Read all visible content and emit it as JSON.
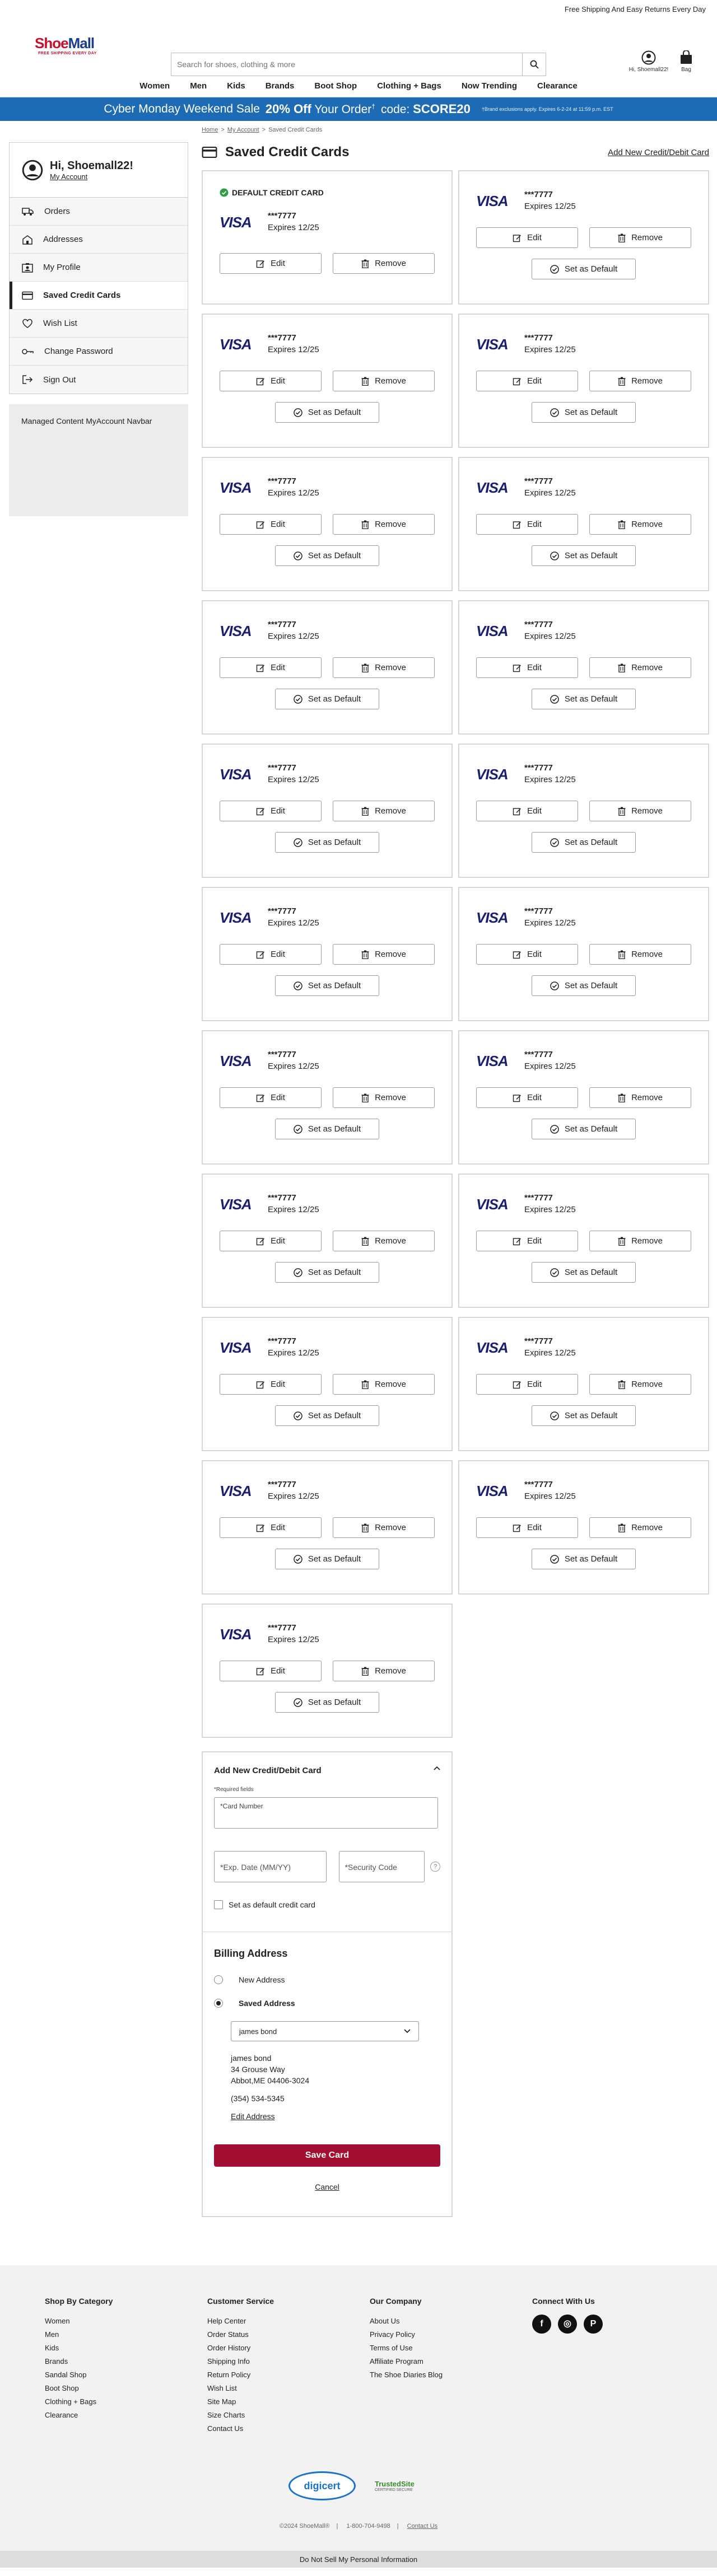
{
  "topbar": {
    "text": "Free Shipping And Easy Returns Every Day"
  },
  "header": {
    "logo_text_a": "Shoe",
    "logo_text_b": "Mall",
    "logo_tagline": "FREE SHIPPING EVERY DAY",
    "search_placeholder": "Search for shoes, clothing & more",
    "account_label": "Hi, Shoemall22!",
    "bag_label": "Bag"
  },
  "nav": {
    "items": [
      "Women",
      "Men",
      "Kids",
      "Brands",
      "Boot Shop",
      "Clothing + Bags",
      "Now Trending",
      "Clearance"
    ]
  },
  "promo": {
    "lead": "Cyber Monday Weekend Sale",
    "discount": "20% Off",
    "your_order": "Your Order",
    "dagger": "†",
    "code_label": "code:",
    "code": "SCORE20",
    "fine_print": "†Brand exclusions apply. Expires 6-2-24 at 11:59 p.m. EST"
  },
  "sidebar": {
    "greeting": "Hi, Shoemall22!",
    "my_account": "My Account",
    "items": [
      "Orders",
      "Addresses",
      "My Profile",
      "Saved Credit Cards",
      "Wish List",
      "Change Password",
      "Sign Out"
    ],
    "active_index": 3,
    "managed_content": "Managed Content MyAccount Navbar"
  },
  "breadcrumb": {
    "home": "Home",
    "account": "My Account",
    "current": "Saved Credit Cards",
    "sep": ">"
  },
  "page": {
    "title": "Saved Credit Cards",
    "add_link": "Add New Credit/Debit Card"
  },
  "cards": {
    "default_label": "DEFAULT CREDIT CARD",
    "brand": "VISA",
    "number": "***7777",
    "expiry": "Expires 12/25",
    "edit_label": "Edit",
    "remove_label": "Remove",
    "set_default_label": "Set as Default",
    "count": 21
  },
  "form": {
    "title": "Add New Credit/Debit Card",
    "required_note": "*Required fields",
    "card_number_label": "*Card Number",
    "exp_label": "*Exp. Date (MM/YY)",
    "cvv_label": "*Security Code",
    "help_glyph": "?",
    "default_checkbox": "Set as default credit card",
    "billing_title": "Billing Address",
    "new_address": "New Address",
    "saved_address": "Saved Address",
    "selected_address": "james bond",
    "addr_name": "james bond",
    "addr_line1": "34 Grouse Way",
    "addr_line2": "Abbot,ME 04406-3024",
    "phone": "(354) 534-5345",
    "edit_address": "Edit Address",
    "save_button": "Save Card",
    "cancel": "Cancel"
  },
  "footer": {
    "col1_title": "Shop By Category",
    "col1": [
      "Women",
      "Men",
      "Kids",
      "Brands",
      "Sandal Shop",
      "Boot Shop",
      "Clothing + Bags",
      "Clearance"
    ],
    "col2_title": "Customer Service",
    "col2": [
      "Help Center",
      "Order Status",
      "Order History",
      "Shipping Info",
      "Return Policy",
      "Wish List",
      "Site Map",
      "Size Charts",
      "Contact Us"
    ],
    "col3_title": "Our Company",
    "col3": [
      "About Us",
      "Privacy Policy",
      "Terms of Use",
      "Affiliate Program",
      "The Shoe Diaries Blog"
    ],
    "col4_title": "Connect With Us",
    "social": [
      "f",
      "◎",
      "P"
    ],
    "digicert": "digicert",
    "trusted_a": "TrustedSite",
    "trusted_b": "CERTIFIED SECURE",
    "copyright": "©2024 ShoeMall®",
    "phone": "1-800-704-9498",
    "contact": "Contact Us",
    "bottom_bar": "Do Not Sell My Personal Information"
  },
  "colors": {
    "brand_blue": "#1a3d8f",
    "brand_red": "#c8102e",
    "promo_bg": "#1d6bb5",
    "save_btn": "#a30f32",
    "visa": "#1a1f71",
    "check_green": "#2e9d48"
  }
}
